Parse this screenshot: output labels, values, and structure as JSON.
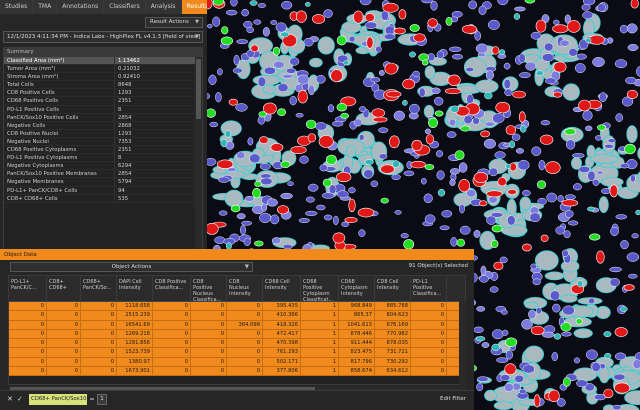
{
  "tabs": [
    {
      "label": "Studies"
    },
    {
      "label": "TMA"
    },
    {
      "label": "Annotations"
    },
    {
      "label": "Classifiers"
    },
    {
      "label": "Analysis"
    },
    {
      "label": "Results",
      "active": true
    }
  ],
  "results": {
    "actions_label": "Result Actions",
    "run_label": "12/1/2023 4:11:34 PM - Indica Labs - HighPlex FL v4.1.3 [field of view]",
    "summary_title": "Summary",
    "rows": [
      {
        "k": "Classified Area (mm²)",
        "v": "1.13462"
      },
      {
        "k": "Tumor Area (mm²)",
        "v": "0.21032"
      },
      {
        "k": "Stroma Area (mm²)",
        "v": "0.92410"
      },
      {
        "k": "Total Cells",
        "v": "8648"
      },
      {
        "k": "CD8 Positive Cells",
        "v": "1293"
      },
      {
        "k": "CD68 Positive Cells",
        "v": "2351"
      },
      {
        "k": "PD-L1 Positive Cells",
        "v": "8"
      },
      {
        "k": "PanCK/Sox10 Positive Cells",
        "v": "2854"
      },
      {
        "k": "Negative Cells",
        "v": "2868"
      },
      {
        "k": "CD8 Positive Nuclei",
        "v": "1293"
      },
      {
        "k": "Negative Nuclei",
        "v": "7353"
      },
      {
        "k": "CD68 Positive Cytoplasms",
        "v": "2351"
      },
      {
        "k": "PD-L1 Positive Cytoplasms",
        "v": "8"
      },
      {
        "k": "Negative Cytoplasms",
        "v": "6294"
      },
      {
        "k": "PanCK/Sox10 Positive Membranes",
        "v": "2854"
      },
      {
        "k": "Negative Membranes",
        "v": "5794"
      },
      {
        "k": "PD-L1+ PanCK/CD8+ Cells",
        "v": "94"
      },
      {
        "k": "CD8+ CD68+ Cells",
        "v": "535"
      }
    ]
  },
  "object_data": {
    "title": "Object Data",
    "actions_label": "Object Actions",
    "selected_label": "91 Object(s) Selected",
    "columns": [
      "PD-L1+ PanCK/C...",
      "CD8+ CD68+",
      "CD68+ PanCK/So...",
      "DAPI Cell Intensity",
      "CD8 Positive Classifica...",
      "CD8 Positive Nucleus Classifica...",
      "CD8 Nucleus Intensity",
      "CD68 Cell Intensity",
      "CD68 Positive Cytoplasm Classificat...",
      "CD68 Cytoplasm Intensity",
      "CD8 Cell Intensity",
      "PD-L1 Positive Classifica..."
    ],
    "rows": [
      [
        "0",
        "0",
        "0",
        "1118.658",
        "0",
        "0",
        "0",
        "395.435",
        "1",
        "968.849",
        "885.788",
        "0"
      ],
      [
        "0",
        "0",
        "0",
        "2515.239",
        "0",
        "0",
        "0",
        "410.366",
        "1",
        "865.37",
        "804.623",
        "0"
      ],
      [
        "0",
        "0",
        "0",
        "16541.69",
        "0",
        "0",
        "364.098",
        "418.326",
        "1",
        "1041.613",
        "676.169",
        "0"
      ],
      [
        "0",
        "0",
        "0",
        "1269.218",
        "0",
        "0",
        "0",
        "472.417",
        "1",
        "878.446",
        "770.982",
        "0"
      ],
      [
        "0",
        "0",
        "0",
        "1281.856",
        "0",
        "0",
        "0",
        "470.398",
        "1",
        "911.444",
        "878.035",
        "0"
      ],
      [
        "0",
        "0",
        "0",
        "1523.739",
        "0",
        "0",
        "0",
        "761.293",
        "1",
        "823.475",
        "731.721",
        "0"
      ],
      [
        "0",
        "0",
        "0",
        "1380.97",
        "0",
        "0",
        "0",
        "502.171",
        "1",
        "817.796",
        "730.292",
        "0"
      ],
      [
        "0",
        "0",
        "0",
        "1673.901",
        "0",
        "0",
        "0",
        "377.806",
        "1",
        "858.674",
        "634.612",
        "0"
      ]
    ],
    "filter": {
      "chip_label": "CD68+ PanCK/Sox10+",
      "operator": "=",
      "value": "1",
      "edit_label": "Edit Filter"
    }
  }
}
